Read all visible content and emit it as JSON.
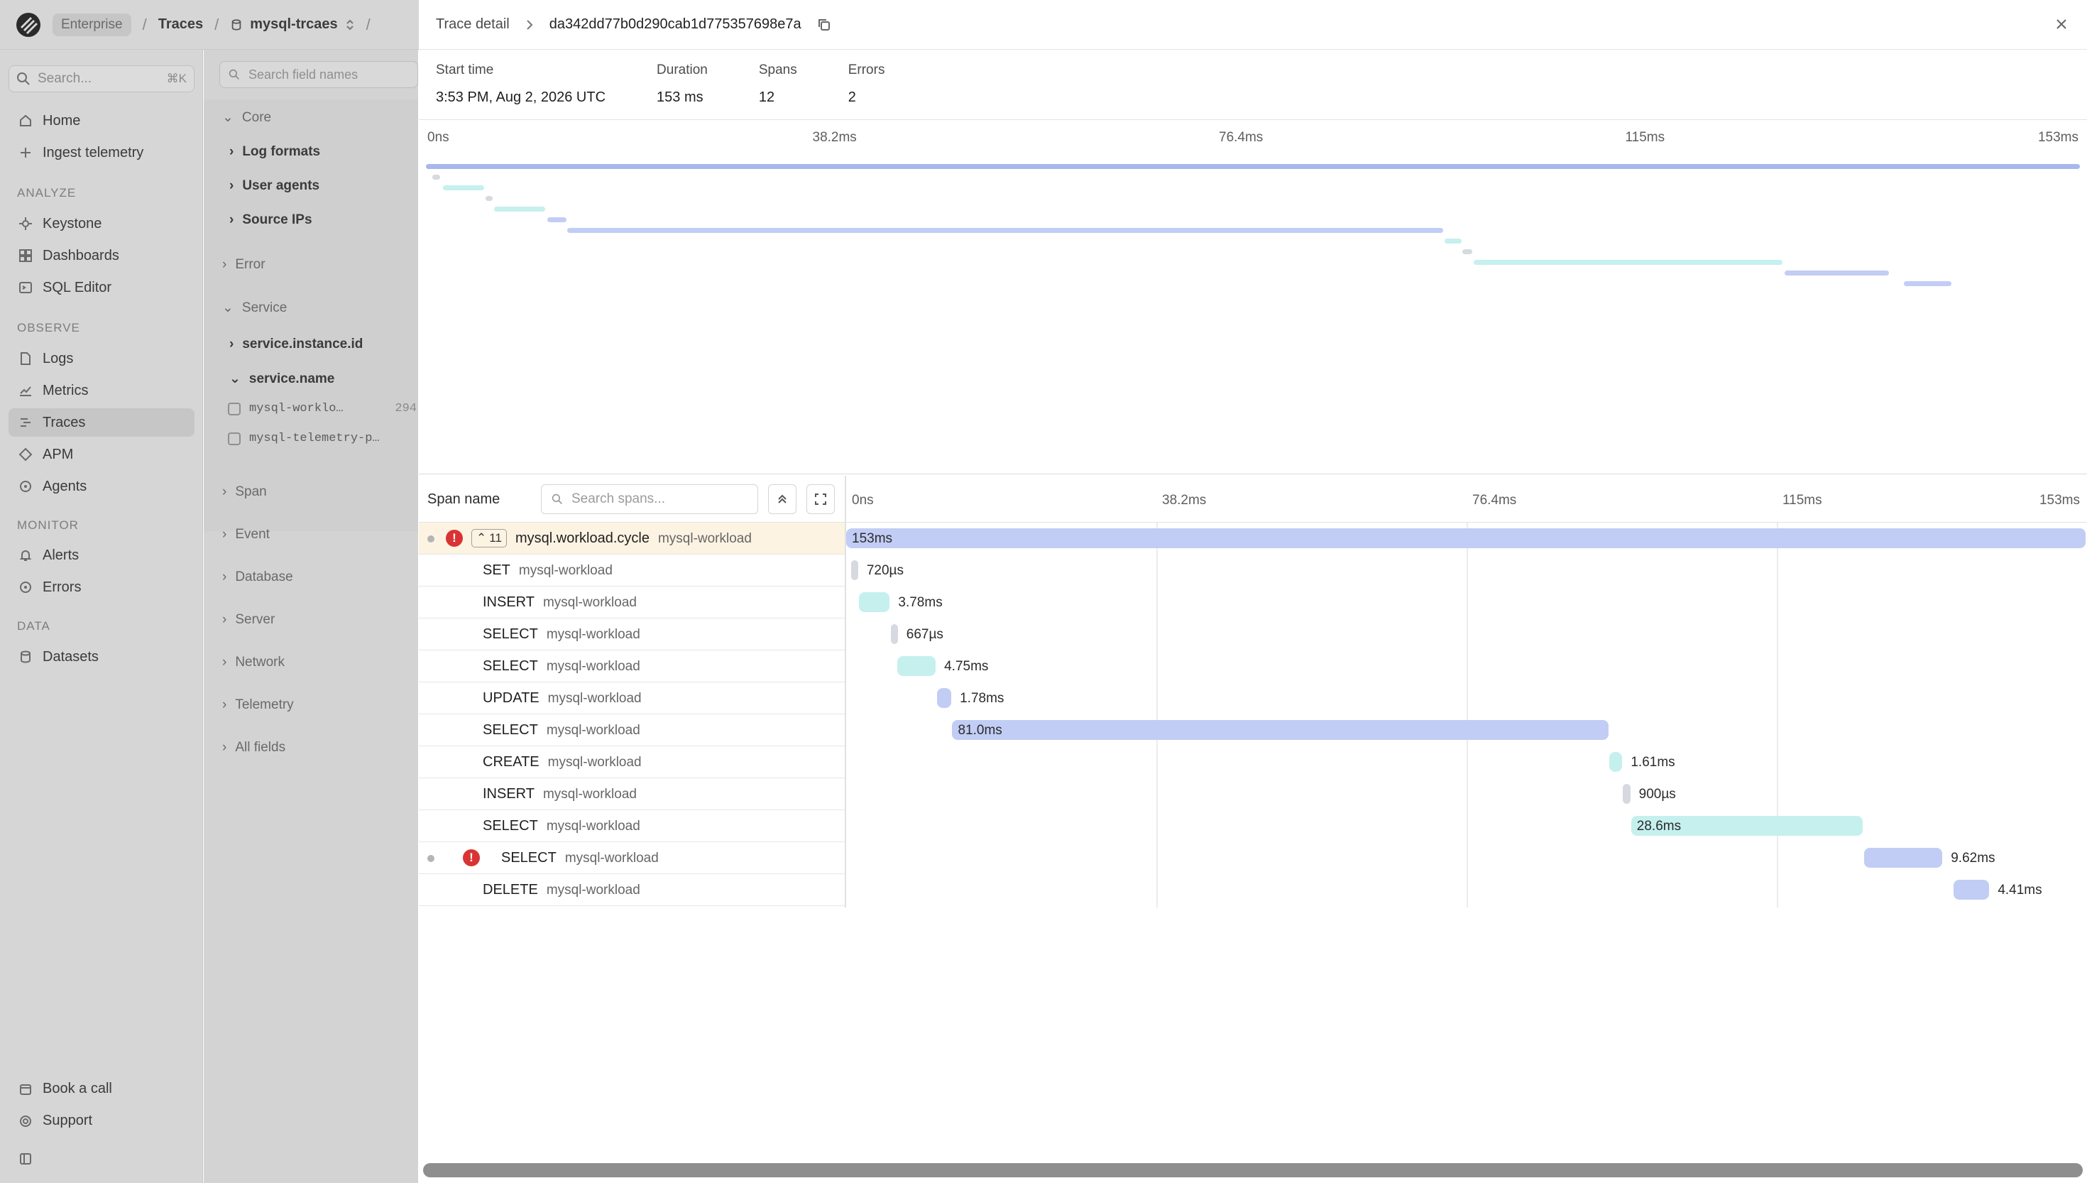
{
  "topbar": {
    "edition": "Enterprise",
    "crumb1": "Traces",
    "crumb2": "mysql-trcaes"
  },
  "sidebar": {
    "search_placeholder": "Search...",
    "search_shortcut": "⌘K",
    "items": {
      "home": "Home",
      "ingest": "Ingest telemetry",
      "keystone": "Keystone",
      "dashboards": "Dashboards",
      "sql": "SQL Editor",
      "logs": "Logs",
      "metrics": "Metrics",
      "traces": "Traces",
      "apm": "APM",
      "agents": "Agents",
      "alerts": "Alerts",
      "errors": "Errors",
      "datasets": "Datasets"
    },
    "sections": {
      "analyze": "ANALYZE",
      "observe": "OBSERVE",
      "monitor": "MONITOR",
      "data": "DATA"
    },
    "footer": {
      "book": "Book a call",
      "support": "Support"
    }
  },
  "fields": {
    "search_placeholder": "Search field names",
    "core": "Core",
    "log_formats": "Log formats",
    "user_agents": "User agents",
    "source_ips": "Source IPs",
    "error": "Error",
    "service": "Service",
    "instance_id": "service.instance.id",
    "service_name": "service.name",
    "val1": "mysql-worklo…",
    "val1_count": "294",
    "val2": "mysql-telemetry-p…",
    "span": "Span",
    "event": "Event",
    "database": "Database",
    "server": "Server",
    "network": "Network",
    "telemetry": "Telemetry",
    "all_fields": "All fields"
  },
  "detail": {
    "title": "Trace detail",
    "trace_id": "da342dd77b0d290cab1d775357698e7a",
    "start_label": "Start time",
    "start_value": "3:53 PM, Aug 2, 2026 UTC",
    "duration_label": "Duration",
    "duration_value": "153 ms",
    "spans_label": "Spans",
    "spans_value": "12",
    "errors_label": "Errors",
    "errors_value": "2"
  },
  "ticks": [
    "0ns",
    "38.2ms",
    "76.4ms",
    "115ms",
    "153ms"
  ],
  "table": {
    "span_name_header": "Span name",
    "search_placeholder": "Search spans...",
    "collapse_count": "11"
  },
  "colors": {
    "blue": "#c2cdf5",
    "teal": "#c5f0ee",
    "gray": "#d6d9e0",
    "error": "#d93434",
    "selected_row": "#fdf3e3"
  },
  "chart_data": {
    "type": "gantt",
    "unit": "ms",
    "total_ms": 153,
    "spans": [
      {
        "name": "mysql.workload.cycle",
        "service": "mysql-workload",
        "start": 0,
        "end": 153,
        "label": "153ms",
        "color": "blue",
        "error": true,
        "depth": 0
      },
      {
        "name": "SET",
        "service": "mysql-workload",
        "start": 0.6,
        "end": 1.32,
        "label": "720µs",
        "color": "gray",
        "depth": 1
      },
      {
        "name": "INSERT",
        "service": "mysql-workload",
        "start": 1.6,
        "end": 5.38,
        "label": "3.78ms",
        "color": "teal",
        "depth": 1
      },
      {
        "name": "SELECT",
        "service": "mysql-workload",
        "start": 5.5,
        "end": 6.17,
        "label": "667µs",
        "color": "gray",
        "depth": 1
      },
      {
        "name": "SELECT",
        "service": "mysql-workload",
        "start": 6.3,
        "end": 11.05,
        "label": "4.75ms",
        "color": "teal",
        "depth": 1
      },
      {
        "name": "UPDATE",
        "service": "mysql-workload",
        "start": 11.2,
        "end": 12.98,
        "label": "1.78ms",
        "color": "blue",
        "depth": 1
      },
      {
        "name": "SELECT",
        "service": "mysql-workload",
        "start": 13.1,
        "end": 94.1,
        "label": "81.0ms",
        "color": "blue",
        "depth": 1
      },
      {
        "name": "CREATE",
        "service": "mysql-workload",
        "start": 94.2,
        "end": 95.81,
        "label": "1.61ms",
        "color": "teal",
        "depth": 1
      },
      {
        "name": "INSERT",
        "service": "mysql-workload",
        "start": 95.9,
        "end": 96.8,
        "label": "900µs",
        "color": "gray",
        "depth": 1
      },
      {
        "name": "SELECT",
        "service": "mysql-workload",
        "start": 96.9,
        "end": 125.5,
        "label": "28.6ms",
        "color": "teal",
        "depth": 1
      },
      {
        "name": "SELECT",
        "service": "mysql-workload",
        "start": 125.7,
        "end": 135.32,
        "label": "9.62ms",
        "color": "blue",
        "error": true,
        "depth": 2
      },
      {
        "name": "DELETE",
        "service": "mysql-workload",
        "start": 136.7,
        "end": 141.11,
        "label": "4.41ms",
        "color": "blue",
        "depth": 1
      }
    ]
  }
}
